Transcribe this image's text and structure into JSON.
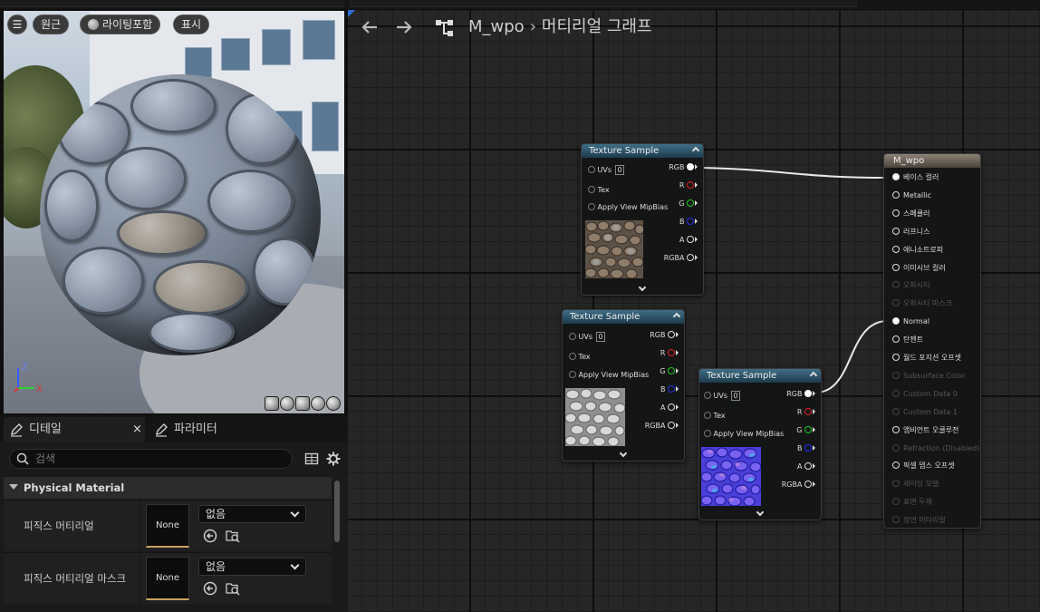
{
  "viewport": {
    "menu_icon": "menu-icon",
    "perspective_label": "원근",
    "lighting_label": "라이팅포함",
    "show_label": "표시",
    "axes": {
      "z": "Z",
      "y": "Y",
      "x": "X"
    }
  },
  "details": {
    "tabs": [
      {
        "label": "디테일",
        "icon": "pencil-icon"
      },
      {
        "label": "파라미터",
        "icon": "pencil-icon"
      }
    ],
    "close_glyph": "×",
    "search_placeholder": "검색",
    "category": "Physical Material",
    "properties": [
      {
        "label": "피직스 머티리얼",
        "thumb": "None",
        "value": "없음"
      },
      {
        "label": "피직스 머티리얼 마스크",
        "thumb": "None",
        "value": "없음"
      }
    ]
  },
  "graph": {
    "title": "M_wpo",
    "breadcrumb_sep": "›",
    "breadcrumb": "머티리얼 그래프",
    "texture_nodes": [
      {
        "title": "Texture Sample",
        "inputs": [
          "UVs",
          "Tex",
          "Apply View MipBias"
        ],
        "uv_value": "0",
        "outputs": [
          "RGB",
          "R",
          "G",
          "B",
          "A",
          "RGBA"
        ],
        "preview": "cobblestone"
      },
      {
        "title": "Texture Sample",
        "inputs": [
          "UVs",
          "Tex",
          "Apply View MipBias"
        ],
        "uv_value": "0",
        "outputs": [
          "RGB",
          "R",
          "G",
          "B",
          "A",
          "RGBA"
        ],
        "preview": "height"
      },
      {
        "title": "Texture Sample",
        "inputs": [
          "UVs",
          "Tex",
          "Apply View MipBias"
        ],
        "uv_value": "0",
        "outputs": [
          "RGB",
          "R",
          "G",
          "B",
          "A",
          "RGBA"
        ],
        "preview": "normal"
      }
    ],
    "result_node": {
      "title": "M_wpo",
      "pins": [
        {
          "label": "베이스 컬러",
          "enabled": true,
          "connected": true
        },
        {
          "label": "Metallic",
          "enabled": true,
          "connected": false
        },
        {
          "label": "스페큘러",
          "enabled": true,
          "connected": false
        },
        {
          "label": "러프니스",
          "enabled": true,
          "connected": false
        },
        {
          "label": "애니소트로피",
          "enabled": true,
          "connected": false
        },
        {
          "label": "이미시브 컬러",
          "enabled": true,
          "connected": false
        },
        {
          "label": "오파시티",
          "enabled": false,
          "connected": false
        },
        {
          "label": "오파시티 마스크",
          "enabled": false,
          "connected": false
        },
        {
          "label": "Normal",
          "enabled": true,
          "connected": true
        },
        {
          "label": "탄젠트",
          "enabled": true,
          "connected": false
        },
        {
          "label": "월드 포지션 오프셋",
          "enabled": true,
          "connected": false
        },
        {
          "label": "Subsurface Color",
          "enabled": false,
          "connected": false
        },
        {
          "label": "Custom Data 0",
          "enabled": false,
          "connected": false
        },
        {
          "label": "Custom Data 1",
          "enabled": false,
          "connected": false
        },
        {
          "label": "앰비언트 오클루전",
          "enabled": true,
          "connected": false
        },
        {
          "label": "Refraction (Disabled)",
          "enabled": false,
          "connected": false
        },
        {
          "label": "픽셀 뎁스 오프셋",
          "enabled": true,
          "connected": false
        },
        {
          "label": "셰이딩 모델",
          "enabled": false,
          "connected": false
        },
        {
          "label": "표면 두께",
          "enabled": false,
          "connected": false
        },
        {
          "label": "정면 머티리얼",
          "enabled": false,
          "connected": false
        }
      ]
    }
  }
}
